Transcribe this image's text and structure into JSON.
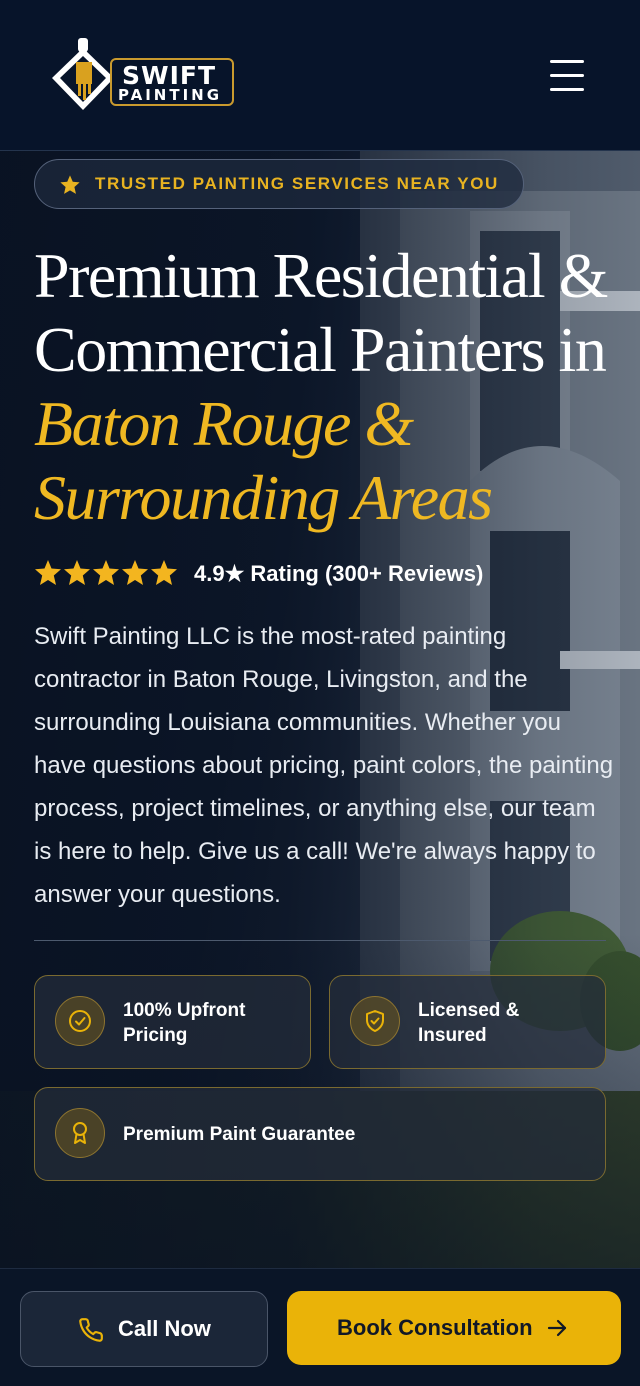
{
  "header": {
    "logo_line1": "SWIFT",
    "logo_line2": "PAINTING",
    "menu_icon": "hamburger-menu-icon"
  },
  "hero": {
    "badge_text": "TRUSTED PAINTING SERVICES NEAR YOU",
    "badge_icon": "star-icon",
    "headline_line1": "Premium Residential &",
    "headline_line2": "Commercial Painters in",
    "headline_highlight1": "Baton Rouge &",
    "headline_highlight2": "Surrounding Areas",
    "rating": {
      "stars": 5,
      "text": "4.9★ Rating (300+ Reviews)"
    },
    "description": "Swift Painting LLC is the most-rated painting contractor in Baton Rouge, Livingston, and the surrounding Louisiana communities. Whether you have questions about pricing, paint colors, the painting process, project timelines, or anything else, our team is here to help. Give us a call! We're always happy to answer your questions.",
    "features": [
      {
        "label": "100% Upfront Pricing",
        "icon": "check-circle-icon"
      },
      {
        "label": "Licensed & Insured",
        "icon": "shield-check-icon"
      },
      {
        "label": "Premium Paint Guarantee",
        "icon": "award-ribbon-icon"
      }
    ]
  },
  "bottom_bar": {
    "call_label": "Call Now",
    "call_icon": "phone-icon",
    "book_label": "Book Consultation",
    "book_icon": "arrow-right-icon"
  },
  "colors": {
    "navy": "#07142a",
    "gold": "#eab308",
    "headline_gold": "#efb822"
  }
}
